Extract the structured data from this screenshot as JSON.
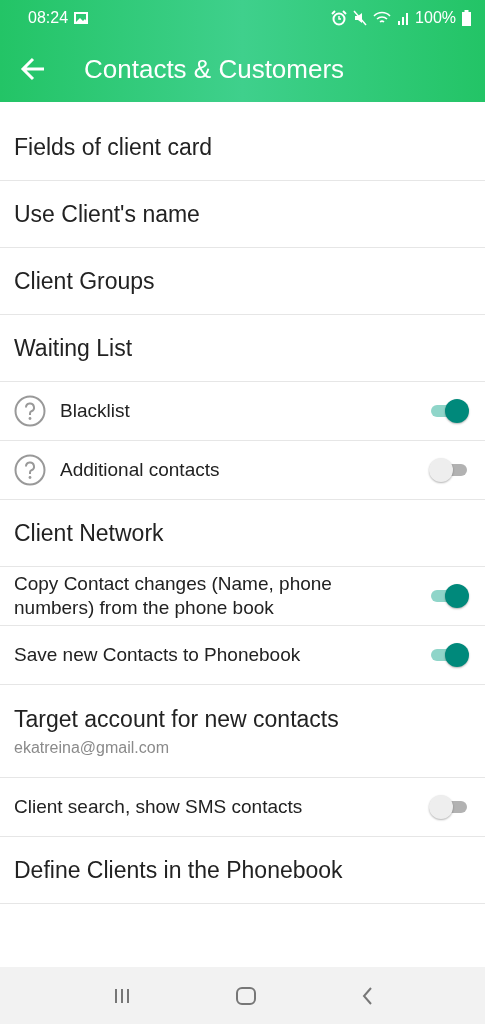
{
  "status_bar": {
    "time": "08:24",
    "battery": "100%"
  },
  "app_bar": {
    "title": "Contacts & Customers"
  },
  "items": [
    {
      "kind": "link",
      "label": "Fields of client card"
    },
    {
      "kind": "link",
      "label": "Use Client's name"
    },
    {
      "kind": "link",
      "label": "Client Groups"
    },
    {
      "kind": "link",
      "label": "Waiting List"
    },
    {
      "kind": "toggle",
      "label": "Blacklist",
      "help": true,
      "on": true
    },
    {
      "kind": "toggle",
      "label": "Additional contacts",
      "help": true,
      "on": false
    },
    {
      "kind": "link",
      "label": "Client Network"
    },
    {
      "kind": "toggle",
      "label": "Copy Contact changes (Name, phone numbers) from the phone book",
      "help": false,
      "on": true
    },
    {
      "kind": "toggle",
      "label": "Save new Contacts to Phonebook",
      "help": false,
      "on": true
    },
    {
      "kind": "link",
      "label": "Target account for new contacts",
      "subtitle": "ekatreina@gmail.com"
    },
    {
      "kind": "toggle",
      "label": "Client search, show SMS contacts",
      "help": false,
      "on": false
    },
    {
      "kind": "link",
      "label": "Define Clients in the Phonebook"
    }
  ]
}
